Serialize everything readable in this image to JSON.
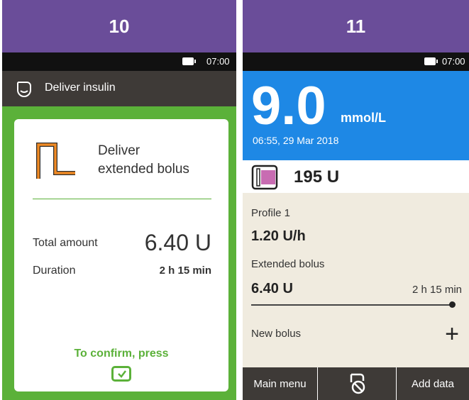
{
  "screen10": {
    "step": "10",
    "status_time": "07:00",
    "title": "Deliver insulin",
    "card": {
      "title_line1": "Deliver",
      "title_line2": "extended bolus",
      "total_label": "Total amount",
      "total_value": "6.40 U",
      "duration_label": "Duration",
      "duration_value": "2 h 15 min",
      "confirm_text": "To confirm, press"
    },
    "icons": [
      "pump-icon",
      "extended-bolus-icon",
      "confirm-check-icon",
      "battery-icon"
    ],
    "colors": {
      "header": "#6a4d99",
      "accent_green": "#5bb139",
      "extended_bolus": "#f08a24"
    }
  },
  "screen11": {
    "step": "11",
    "status_time": "07:00",
    "bg": {
      "value": "9.0",
      "unit": "mmol/L",
      "timestamp": "06:55, 29 Mar 2018"
    },
    "reservoir": "195 U",
    "profile_label": "Profile 1",
    "basal_rate": "1.20 U/h",
    "extended_bolus_label": "Extended bolus",
    "extended_bolus_value": "6.40 U",
    "extended_bolus_remaining": "2 h 15 min",
    "extended_bolus_progress": 1.0,
    "new_bolus_label": "New bolus",
    "bottom": {
      "main_menu": "Main menu",
      "add_data": "Add data"
    },
    "icons": [
      "reservoir-icon",
      "plus-icon",
      "stop-pump-icon",
      "battery-icon"
    ],
    "colors": {
      "bg_panel": "#1e88e5",
      "reservoir_fill": "#c86cb2"
    }
  }
}
